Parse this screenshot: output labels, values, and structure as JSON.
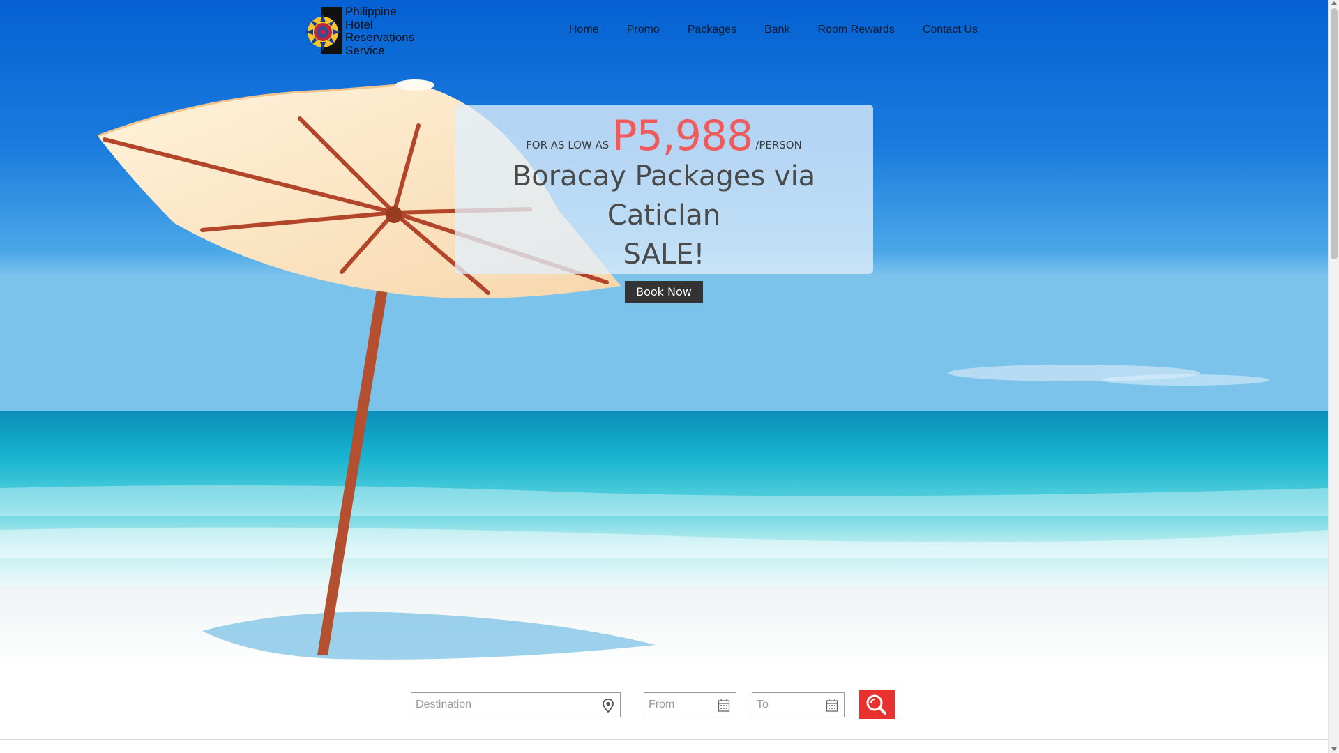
{
  "brand": {
    "logo_lines": [
      "Philippine",
      "Hotel",
      "Reservations",
      "Service"
    ]
  },
  "nav": {
    "items": [
      "Home",
      "Promo",
      "Packages",
      "Bank",
      "Room Rewards",
      "Contact Us"
    ]
  },
  "promo": {
    "prefix": "FOR AS LOW AS",
    "price": "P5,988",
    "suffix": "/PERSON",
    "title_line1": "Boracay Packages via Caticlan",
    "title_line2": "SALE!",
    "cta": "Book Now"
  },
  "search": {
    "destination_placeholder": "Destination",
    "from_placeholder": "From",
    "to_placeholder": "To"
  },
  "colors": {
    "price": "#ef5b5b",
    "search_button": "#e8322f",
    "cta_bg": "#333333"
  },
  "icons": {
    "destination": "map-pin-icon",
    "from": "calendar-icon",
    "to": "calendar-icon",
    "search": "search-icon"
  }
}
